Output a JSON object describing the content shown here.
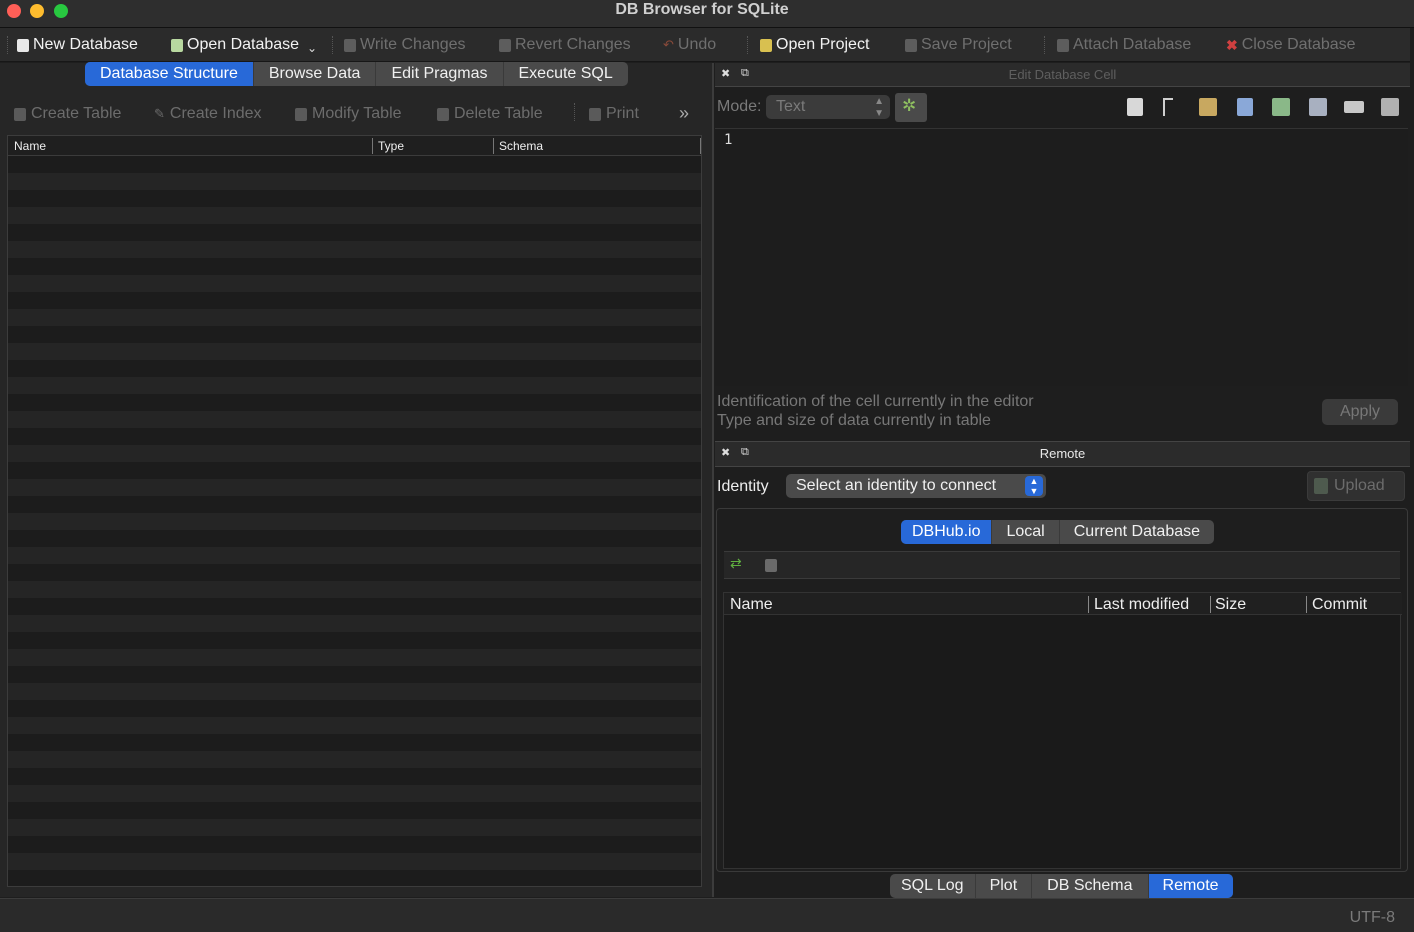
{
  "window": {
    "title": "DB Browser for SQLite"
  },
  "toolbar": {
    "new_database": "New Database",
    "open_database": "Open Database",
    "write_changes": "Write Changes",
    "revert_changes": "Revert Changes",
    "undo": "Undo",
    "open_project": "Open Project",
    "save_project": "Save Project",
    "attach_database": "Attach Database",
    "close_database": "Close Database"
  },
  "main_tabs": [
    {
      "label": "Database Structure",
      "active": true
    },
    {
      "label": "Browse Data",
      "active": false
    },
    {
      "label": "Edit Pragmas",
      "active": false
    },
    {
      "label": "Execute SQL",
      "active": false
    }
  ],
  "structure_toolbar": {
    "create_table": "Create Table",
    "create_index": "Create Index",
    "modify_table": "Modify Table",
    "delete_table": "Delete Table",
    "print": "Print"
  },
  "structure_table": {
    "columns": [
      "Name",
      "Type",
      "Schema"
    ]
  },
  "edit_cell": {
    "title": "Edit Database Cell",
    "mode_label": "Mode:",
    "mode_value": "Text",
    "editor_line": "1",
    "info_line_1": "Identification of the cell currently in the editor",
    "info_line_2": "Type and size of data currently in table",
    "apply": "Apply"
  },
  "remote": {
    "title": "Remote",
    "identity_label": "Identity",
    "identity_placeholder": "Select an identity to connect",
    "upload": "Upload",
    "tabs": [
      {
        "label": "DBHub.io",
        "active": true
      },
      {
        "label": "Local",
        "active": false
      },
      {
        "label": "Current Database",
        "active": false
      }
    ],
    "columns": [
      "Name",
      "Last modified",
      "Size",
      "Commit"
    ]
  },
  "bottom_tabs": [
    {
      "label": "SQL Log",
      "active": false
    },
    {
      "label": "Plot",
      "active": false
    },
    {
      "label": "DB Schema",
      "active": false
    },
    {
      "label": "Remote",
      "active": true
    }
  ],
  "statusbar": {
    "encoding": "UTF-8"
  },
  "colors": {
    "accent": "#2869d8",
    "close_red": "#ff5f57",
    "minimize_yellow": "#febc2e",
    "zoom_green": "#28c840"
  }
}
